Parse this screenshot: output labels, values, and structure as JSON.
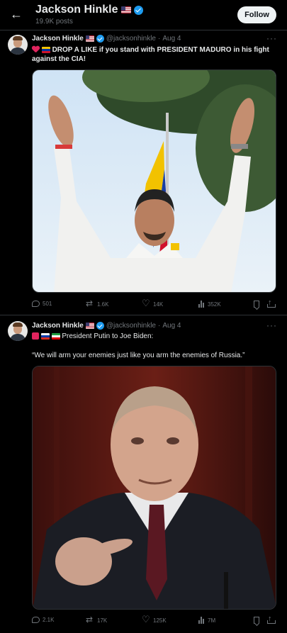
{
  "header": {
    "back_icon": "arrow-left-icon",
    "name": "Jackson Hinkle",
    "post_count": "19.9K posts",
    "follow_label": "Follow"
  },
  "tweets": [
    {
      "name": "Jackson Hinkle",
      "handle": "@jacksonhinkle",
      "sep": "·",
      "date": "Aug 4",
      "more": "···",
      "emoji": [
        "red-heart",
        "venezuela-flag"
      ],
      "text": "DROP A LIKE if you stand with PRESIDENT MADURO in his fight against the CIA!",
      "stats": {
        "replies": "501",
        "reposts": "1.6K",
        "likes": "14K",
        "views": "352K"
      }
    },
    {
      "name": "Jackson Hinkle",
      "handle": "@jacksonhinkle",
      "sep": "·",
      "date": "Aug 4",
      "more": "···",
      "emoji": [
        "red-pin",
        "russia-flag",
        "iran-flag"
      ],
      "text": "President Putin to Joe Biden:",
      "quote": "“We will arm your enemies just like you arm the enemies of Russia.”",
      "stats": {
        "replies": "2.1K",
        "reposts": "17K",
        "likes": "125K",
        "views": "7M"
      }
    }
  ],
  "colors": {
    "background": "#000000",
    "text": "#e7e9ea",
    "muted": "#71767b",
    "verified": "#1d9bf0",
    "divider": "#2f3336"
  }
}
